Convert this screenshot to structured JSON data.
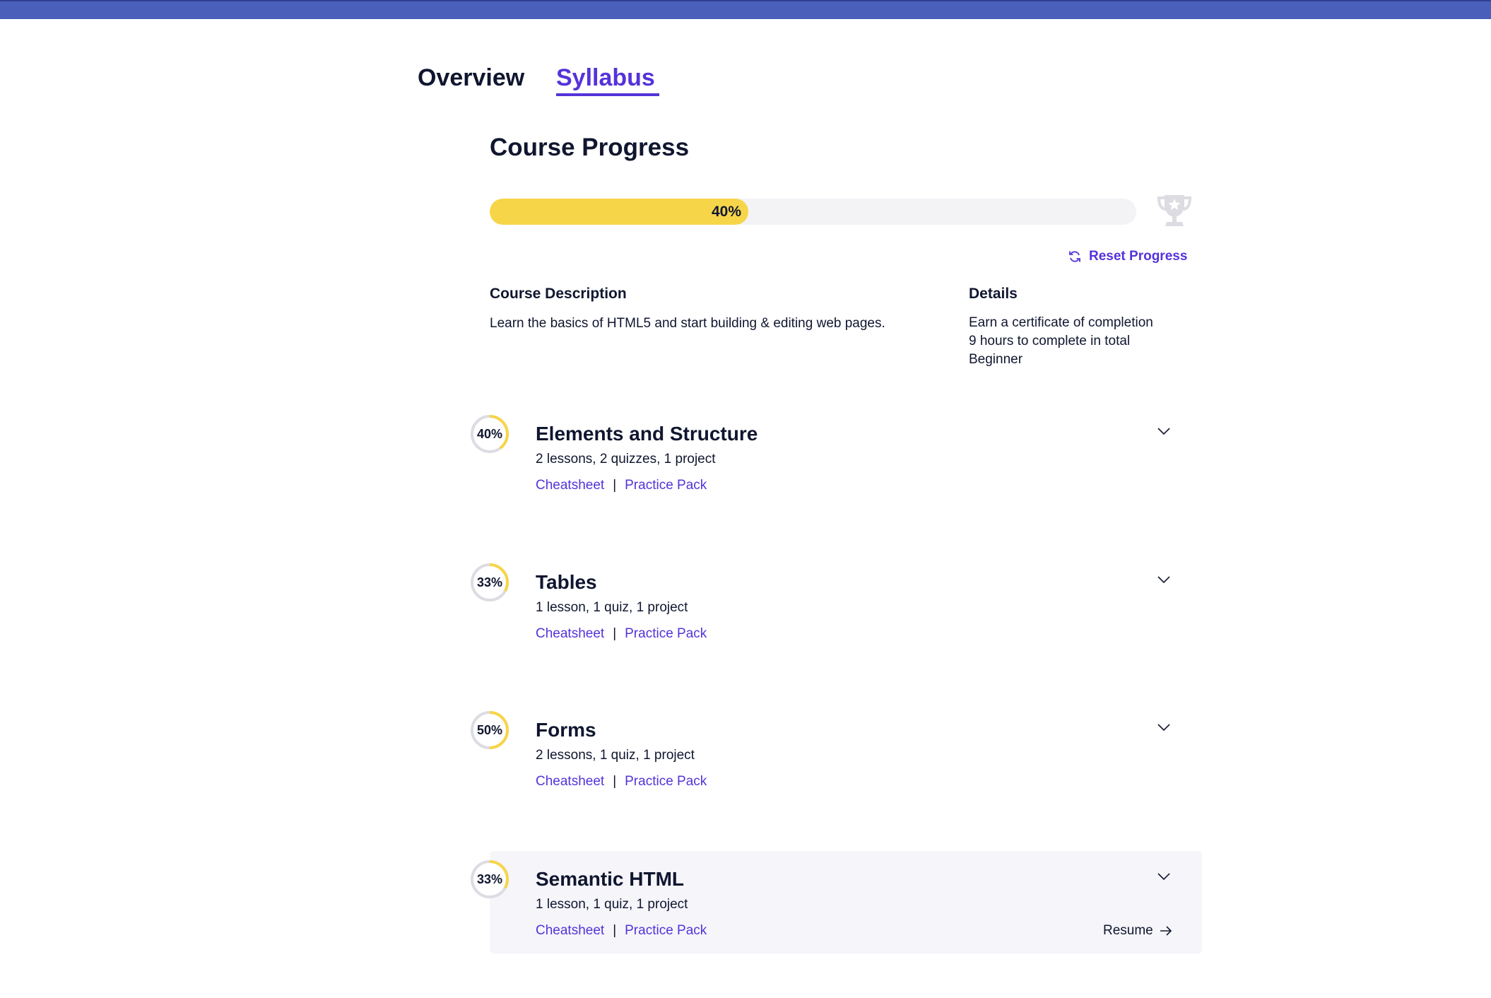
{
  "tabs": {
    "overview": "Overview",
    "syllabus": "Syllabus"
  },
  "progress": {
    "title": "Course Progress",
    "percent": 40,
    "percent_label": "40%",
    "reset_label": "Reset Progress"
  },
  "description": {
    "heading": "Course Description",
    "text": "Learn the basics of HTML5 and start building & editing web pages."
  },
  "details": {
    "heading": "Details",
    "items": [
      "Earn a certificate of completion",
      "9 hours to complete in total",
      "Beginner"
    ]
  },
  "modules": [
    {
      "title": "Elements and Structure",
      "meta": "2 lessons, 2 quizzes, 1 project",
      "percent": 40,
      "percent_label": "40%",
      "cheatsheet": "Cheatsheet",
      "separator": "|",
      "practice": "Practice Pack"
    },
    {
      "title": "Tables",
      "meta": "1 lesson, 1 quiz, 1 project",
      "percent": 33,
      "percent_label": "33%",
      "cheatsheet": "Cheatsheet",
      "separator": "|",
      "practice": "Practice Pack"
    },
    {
      "title": "Forms",
      "meta": "2 lessons, 1 quiz, 1 project",
      "percent": 50,
      "percent_label": "50%",
      "cheatsheet": "Cheatsheet",
      "separator": "|",
      "practice": "Practice Pack"
    },
    {
      "title": "Semantic HTML",
      "meta": "1 lesson, 1 quiz, 1 project",
      "percent": 33,
      "percent_label": "33%",
      "cheatsheet": "Cheatsheet",
      "separator": "|",
      "practice": "Practice Pack",
      "resume": "Resume"
    }
  ],
  "colors": {
    "accent": "#5533d9",
    "progress": "#f7d548",
    "header_bar": "#4a5fba",
    "ring_track": "#dcdce2"
  },
  "icons": {
    "reset": "refresh-icon",
    "trophy": "trophy-icon",
    "chevron": "chevron-down-icon",
    "resume": "arrow-right-icon"
  }
}
